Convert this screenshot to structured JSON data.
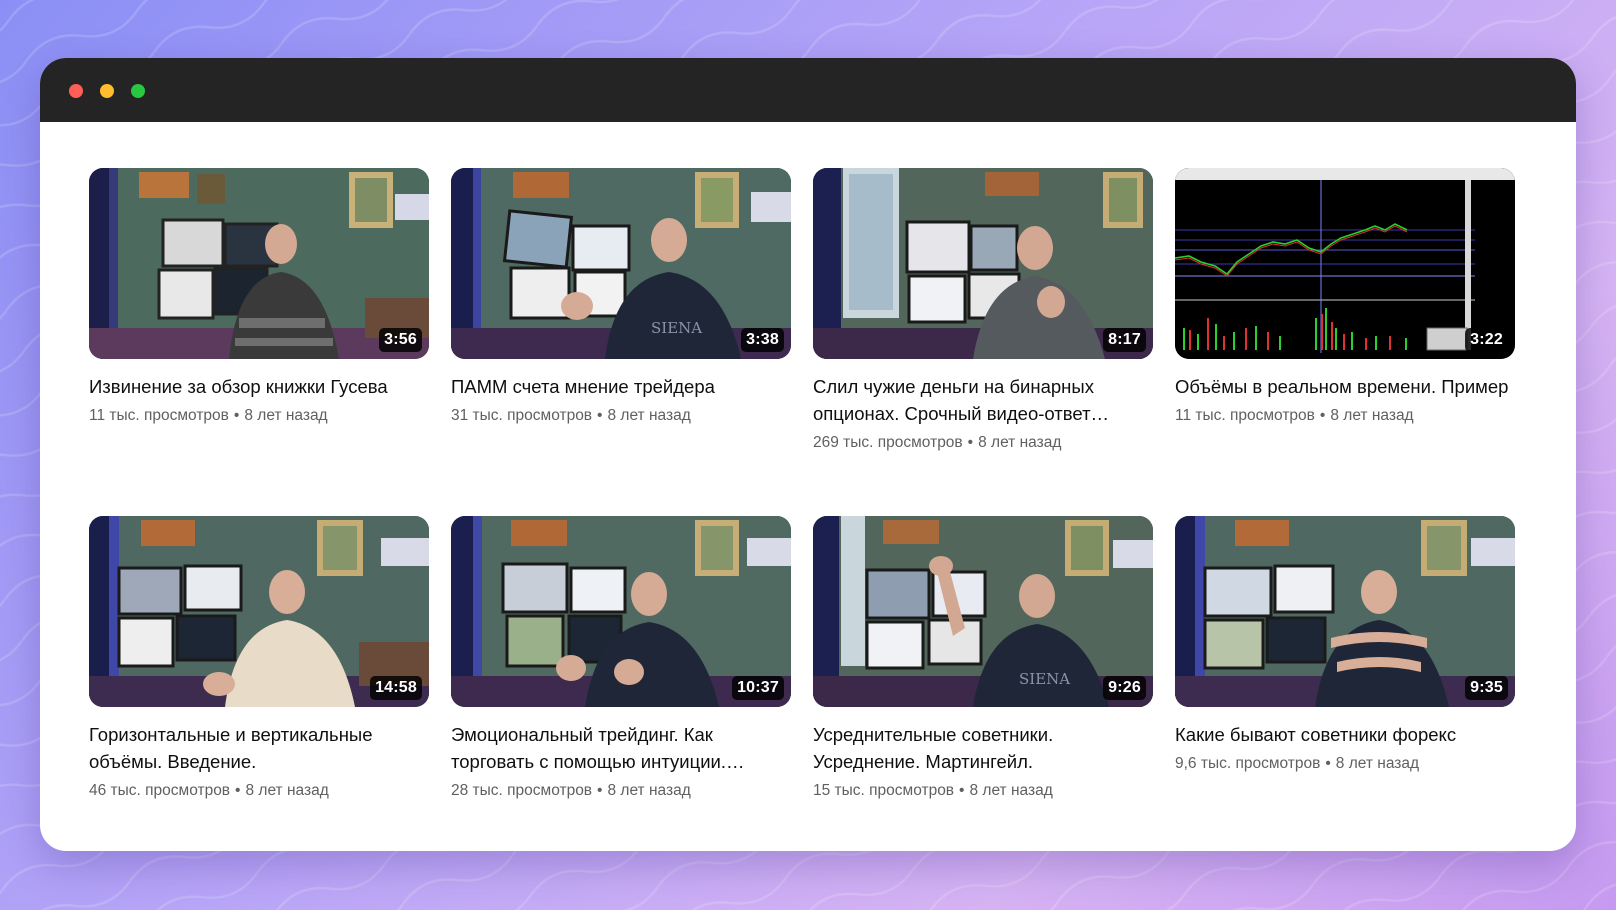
{
  "window": {
    "controls": [
      "close",
      "minimize",
      "maximize"
    ]
  },
  "colors": {
    "accent_red": "#ff5f57",
    "accent_yellow": "#febc2e",
    "accent_green": "#28c840",
    "titlebar": "#242424",
    "title_text": "#0f0f0f",
    "meta_text": "#606060"
  },
  "videos": [
    {
      "title": "Извинение за обзор книжки Гусева",
      "views": "11 тыс. просмотров",
      "separator": "•",
      "age": "8 лет назад",
      "duration": "3:56"
    },
    {
      "title": "ПАММ счета мнение трейдера",
      "views": "31 тыс. просмотров",
      "separator": "•",
      "age": "8 лет назад",
      "duration": "3:38"
    },
    {
      "title": "Слил чужие деньги на бинарных опционах. Срочный видео-ответ…",
      "views": "269 тыс. просмотров",
      "separator": "•",
      "age": "8 лет назад",
      "duration": "8:17"
    },
    {
      "title": "Объёмы в реальном времени. Пример",
      "views": "11 тыс. просмотров",
      "separator": "•",
      "age": "8 лет назад",
      "duration": "3:22"
    },
    {
      "title": "Горизонтальные и вертикальные объёмы. Введение.",
      "views": "46 тыс. просмотров",
      "separator": "•",
      "age": "8 лет назад",
      "duration": "14:58"
    },
    {
      "title": "Эмоциональный трейдинг. Как торговать с помощью интуиции.…",
      "views": "28 тыс. просмотров",
      "separator": "•",
      "age": "8 лет назад",
      "duration": "10:37"
    },
    {
      "title": "Усреднительные советники. Усреднение. Мартингейл.",
      "views": "15 тыс. просмотров",
      "separator": "•",
      "age": "8 лет назад",
      "duration": "9:26"
    },
    {
      "title": "Какие бывают советники форекс",
      "views": "9,6 тыс. просмотров",
      "separator": "•",
      "age": "8 лет назад",
      "duration": "9:35"
    }
  ]
}
